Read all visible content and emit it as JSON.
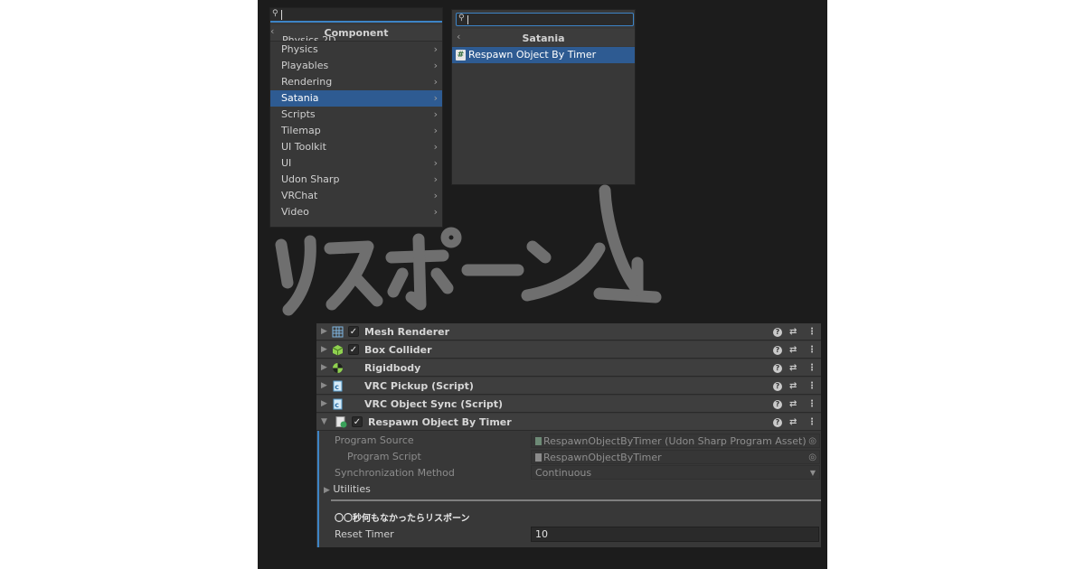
{
  "component_menu": {
    "title": "Component",
    "clipped_item": "Physics 2D",
    "items": [
      {
        "label": "Physics",
        "selected": false
      },
      {
        "label": "Playables",
        "selected": false
      },
      {
        "label": "Rendering",
        "selected": false
      },
      {
        "label": "Satania",
        "selected": true
      },
      {
        "label": "Scripts",
        "selected": false
      },
      {
        "label": "Tilemap",
        "selected": false
      },
      {
        "label": "UI Toolkit",
        "selected": false
      },
      {
        "label": "UI",
        "selected": false
      },
      {
        "label": "Udon Sharp",
        "selected": false
      },
      {
        "label": "VRChat",
        "selected": false
      },
      {
        "label": "Video",
        "selected": false
      }
    ]
  },
  "satania_menu": {
    "title": "Satania",
    "items": [
      {
        "label": "Respawn Object By Timer",
        "icon": "csharp-script-icon",
        "selected": true
      }
    ]
  },
  "annotation": {
    "handwritten_text": "リスポーン",
    "arrow": "down-right"
  },
  "inspector": {
    "components": [
      {
        "name": "Mesh Renderer",
        "icon": "mesh-renderer-icon",
        "checkbox": true,
        "checked": true
      },
      {
        "name": "Box Collider",
        "icon": "box-collider-icon",
        "checkbox": true,
        "checked": true
      },
      {
        "name": "Rigidbody",
        "icon": "rigidbody-icon",
        "checkbox": false,
        "checked": false
      },
      {
        "name": "VRC Pickup (Script)",
        "icon": "script-icon",
        "checkbox": false,
        "checked": false
      },
      {
        "name": "VRC Object Sync (Script)",
        "icon": "script-icon",
        "checkbox": false,
        "checked": false
      },
      {
        "name": "Respawn Object By Timer",
        "icon": "udon-script-icon",
        "checkbox": true,
        "checked": true,
        "expanded": true
      }
    ],
    "expanded": {
      "program_source_label": "Program Source",
      "program_source_value": "RespawnObjectByTimer (Udon Sharp Program Asset)",
      "program_script_label": "Program Script",
      "program_script_value": "RespawnObjectByTimer",
      "sync_method_label": "Synchronization Method",
      "sync_method_value": "Continuous",
      "utilities_label": "Utilities",
      "section_header": "〇〇秒何もなかったらリスポーン",
      "reset_timer_label": "Reset Timer",
      "reset_timer_value": "10"
    }
  },
  "colors": {
    "selection": "#2e5b92",
    "focus": "#3d84c6",
    "panel": "#383838",
    "backdrop": "#1c1c1c",
    "scribble": "#6f6f6f"
  }
}
